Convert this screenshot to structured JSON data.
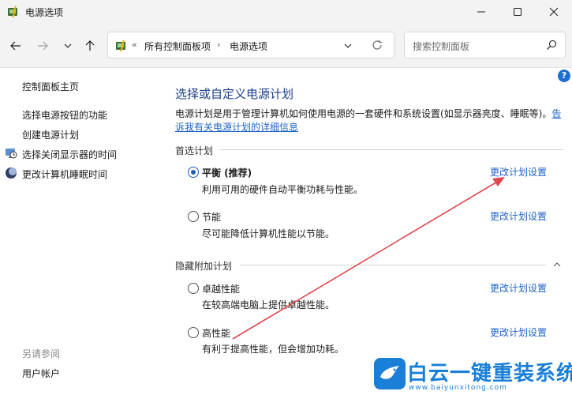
{
  "window": {
    "title": "电源选项",
    "icon": "power-options-icon"
  },
  "address": {
    "breadcrumb_prefix": "«",
    "crumbs": [
      "所有控制面板项",
      "电源选项"
    ],
    "crumb_separator": "›",
    "search_placeholder": "搜索控制面板"
  },
  "help": {
    "label": "?"
  },
  "sidebar": {
    "items": [
      {
        "label": "控制面板主页",
        "icon": null
      },
      {
        "label": "选择电源按钮的功能",
        "icon": null
      },
      {
        "label": "创建电源计划",
        "icon": null
      },
      {
        "label": "选择关闭显示器的时间",
        "icon": "monitor-clock-icon"
      },
      {
        "label": "更改计算机睡眠时间",
        "icon": "moon-icon"
      }
    ],
    "see_also_heading": "另请参阅",
    "see_also": [
      {
        "label": "用户帐户"
      }
    ]
  },
  "main": {
    "heading": "选择或自定义电源计划",
    "description": "电源计划是用于管理计算机如何使用电源的一套硬件和系统设置(如显示器亮度、睡眠等)。",
    "description_link": "告诉我有关电源计划的详细信息",
    "preferred_heading": "首选计划",
    "hidden_heading": "隐藏附加计划",
    "plans": [
      {
        "name": "平衡 (推荐)",
        "description": "利用可用的硬件自动平衡功耗与性能。",
        "link": "更改计划设置",
        "selected": true
      },
      {
        "name": "节能",
        "description": "尽可能降低计算机性能以节能。",
        "link": "更改计划设置",
        "selected": false
      }
    ],
    "hidden_plans": [
      {
        "name": "卓越性能",
        "description": "在较高端电脑上提供卓越性能。",
        "link": "更改计划设置",
        "selected": false
      },
      {
        "name": "高性能",
        "description": "有利于提高性能，但会增加功耗。",
        "link": "更改计划设置",
        "selected": false
      }
    ]
  },
  "watermark": {
    "title": "白云一键重装系统",
    "url": "www.baiyunxitong.com"
  },
  "colors": {
    "link": "#1e64c8",
    "heading": "#1e3f8a",
    "arrow": "#e0474c",
    "watermark": "#1a7fd6"
  }
}
